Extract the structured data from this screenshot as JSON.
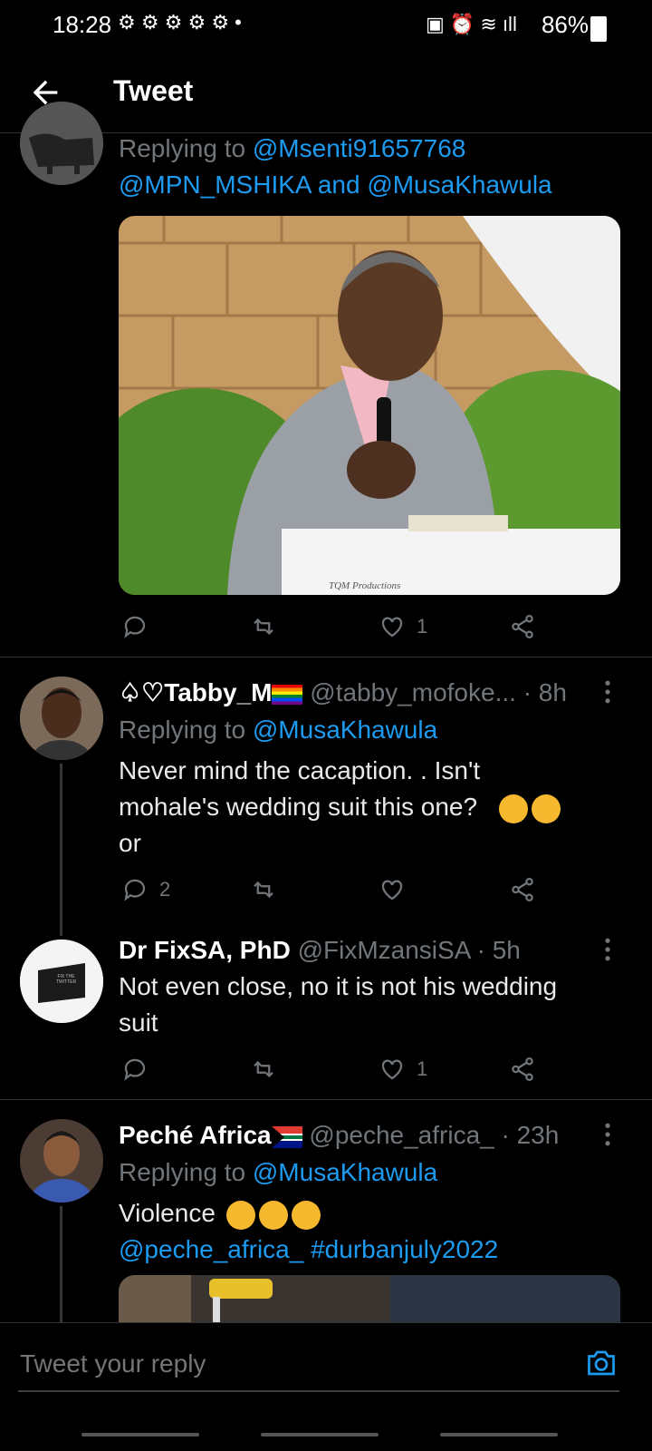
{
  "status": {
    "time": "18:28",
    "battery": "86%"
  },
  "header": {
    "title": "Tweet"
  },
  "tweet1": {
    "replying_prefix": "Replying to",
    "replying_to_1": "@Msenti91657768",
    "replying_to_2": "@MPN_MSHIKA",
    "and": "and",
    "replying_to_3": "@MusaKhawula",
    "image_watermark": "TQM Productions",
    "likes": "1"
  },
  "tweet2": {
    "name": "♤♡Tabby_M",
    "handle": "@tabby_mofoke...",
    "time": "· 8h",
    "replying_prefix": "Replying to",
    "replying_to": "@MusaKhawula",
    "text_line1": "Never mind the cacaption. . Isn't",
    "text_line2": "mohale's wedding suit this one?",
    "text_line3": "or",
    "replies": "2"
  },
  "tweet3": {
    "name": "Dr FixSA, PhD",
    "handle": "@FixMzansiSA",
    "time": "· 5h",
    "text_line1": "Not even close, no it is not his wedding",
    "text_line2": "suit",
    "likes": "1",
    "avatar_text": "FIX THE TWITTER"
  },
  "tweet4": {
    "name": "Peché Africa",
    "handle": "@peche_africa_",
    "time": "· 23h",
    "replying_prefix": "Replying to",
    "replying_to": "@MusaKhawula",
    "text": "Violence",
    "mention": "@peche_africa_",
    "hashtag": "#durbanjuly2022"
  },
  "reply": {
    "placeholder": "Tweet your reply"
  }
}
